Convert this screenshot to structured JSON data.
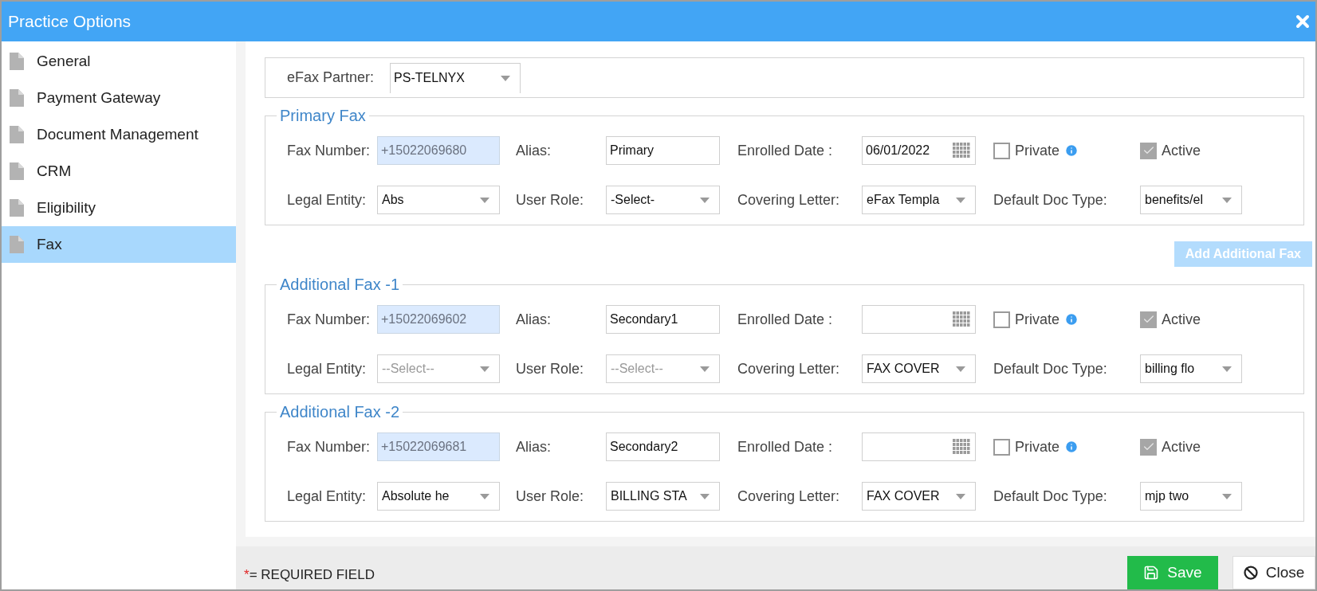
{
  "window": {
    "title": "Practice Options"
  },
  "sidebar": {
    "items": [
      {
        "label": "General",
        "selected": false
      },
      {
        "label": "Payment Gateway",
        "selected": false
      },
      {
        "label": "Document Management",
        "selected": false
      },
      {
        "label": "CRM",
        "selected": false
      },
      {
        "label": "Eligibility",
        "selected": false
      },
      {
        "label": "Fax",
        "selected": true
      }
    ]
  },
  "efax_partner": {
    "label": "eFax Partner:",
    "value": "PS-TELNYX"
  },
  "add_button": "Add Additional Fax",
  "sections": [
    {
      "title": "Primary Fax",
      "fax_number": {
        "label": "Fax Number:",
        "value": "+15022069680"
      },
      "alias": {
        "label": "Alias:",
        "value": "Primary"
      },
      "enrolled_date": {
        "label": "Enrolled Date :",
        "value": "06/01/2022"
      },
      "private": {
        "label": "Private",
        "checked": false
      },
      "active": {
        "label": "Active",
        "checked": true
      },
      "legal_entity": {
        "label": "Legal Entity:",
        "value": "Abs"
      },
      "user_role": {
        "label": "User Role:",
        "value": "-Select-"
      },
      "covering_letter": {
        "label": "Covering Letter:",
        "value": "eFax Templa"
      },
      "default_doc_type": {
        "label": "Default Doc Type:",
        "value": "benefits/el"
      }
    },
    {
      "title": "Additional Fax -1",
      "fax_number": {
        "label": "Fax Number:",
        "value": "+15022069602"
      },
      "alias": {
        "label": "Alias:",
        "value": "Secondary1"
      },
      "enrolled_date": {
        "label": "Enrolled Date :"
      },
      "private": {
        "label": "Private",
        "checked": false
      },
      "active": {
        "label": "Active",
        "checked": true
      },
      "legal_entity": {
        "label": "Legal Entity:",
        "placeholder": "--Select--"
      },
      "user_role": {
        "label": "User Role:",
        "placeholder": "--Select--"
      },
      "covering_letter": {
        "label": "Covering Letter:",
        "value": "FAX COVER"
      },
      "default_doc_type": {
        "label": "Default Doc Type:",
        "value": "billing flo"
      }
    },
    {
      "title": "Additional Fax -2",
      "fax_number": {
        "label": "Fax Number:",
        "value": "+15022069681"
      },
      "alias": {
        "label": "Alias:",
        "value": "Secondary2"
      },
      "enrolled_date": {
        "label": "Enrolled Date :"
      },
      "private": {
        "label": "Private",
        "checked": false
      },
      "active": {
        "label": "Active",
        "checked": true
      },
      "legal_entity": {
        "label": "Legal Entity:",
        "value": "Absolute he"
      },
      "user_role": {
        "label": "User Role:",
        "value": "BILLING STA"
      },
      "covering_letter": {
        "label": "Covering Letter:",
        "value": "FAX COVER"
      },
      "default_doc_type": {
        "label": "Default Doc Type:",
        "value": "mjp two"
      }
    }
  ],
  "footer": {
    "required_mark": "*",
    "required_note": "= REQUIRED FIELD",
    "buttons": [
      {
        "kind": "save",
        "label": "Save"
      },
      {
        "kind": "close",
        "label": "Close"
      }
    ]
  }
}
